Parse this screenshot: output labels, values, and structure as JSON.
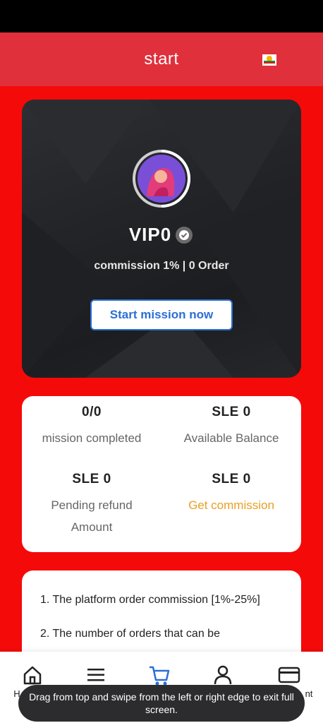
{
  "header": {
    "title": "start"
  },
  "hero": {
    "level": "VIP0",
    "commission_text": "commission  1% | 0 Order",
    "start_button": "Start mission now"
  },
  "stats": [
    {
      "value": "0/0",
      "label": "mission completed"
    },
    {
      "value": "SLE 0",
      "label": "Available Balance"
    },
    {
      "value": "SLE 0",
      "label": "Pending refund Amount"
    },
    {
      "value": "SLE 0",
      "label": "Get commission"
    }
  ],
  "rules": [
    "1. The platform order commission [1%-25%]",
    "2. The number of orders that can be"
  ],
  "nav": [
    {
      "icon": "home-icon",
      "label": "H"
    },
    {
      "icon": "menu-icon",
      "label": ""
    },
    {
      "icon": "cart-icon",
      "label": ""
    },
    {
      "icon": "user-icon",
      "label": ""
    },
    {
      "icon": "card-icon",
      "label": "nt"
    }
  ],
  "toast": {
    "text": "Drag from top and swipe from the left or right edge to exit full screen."
  },
  "colors": {
    "header": "#e0303c",
    "background": "#f50a0a",
    "accent": "#2a6fd6",
    "commission_link": "#e8a023"
  }
}
